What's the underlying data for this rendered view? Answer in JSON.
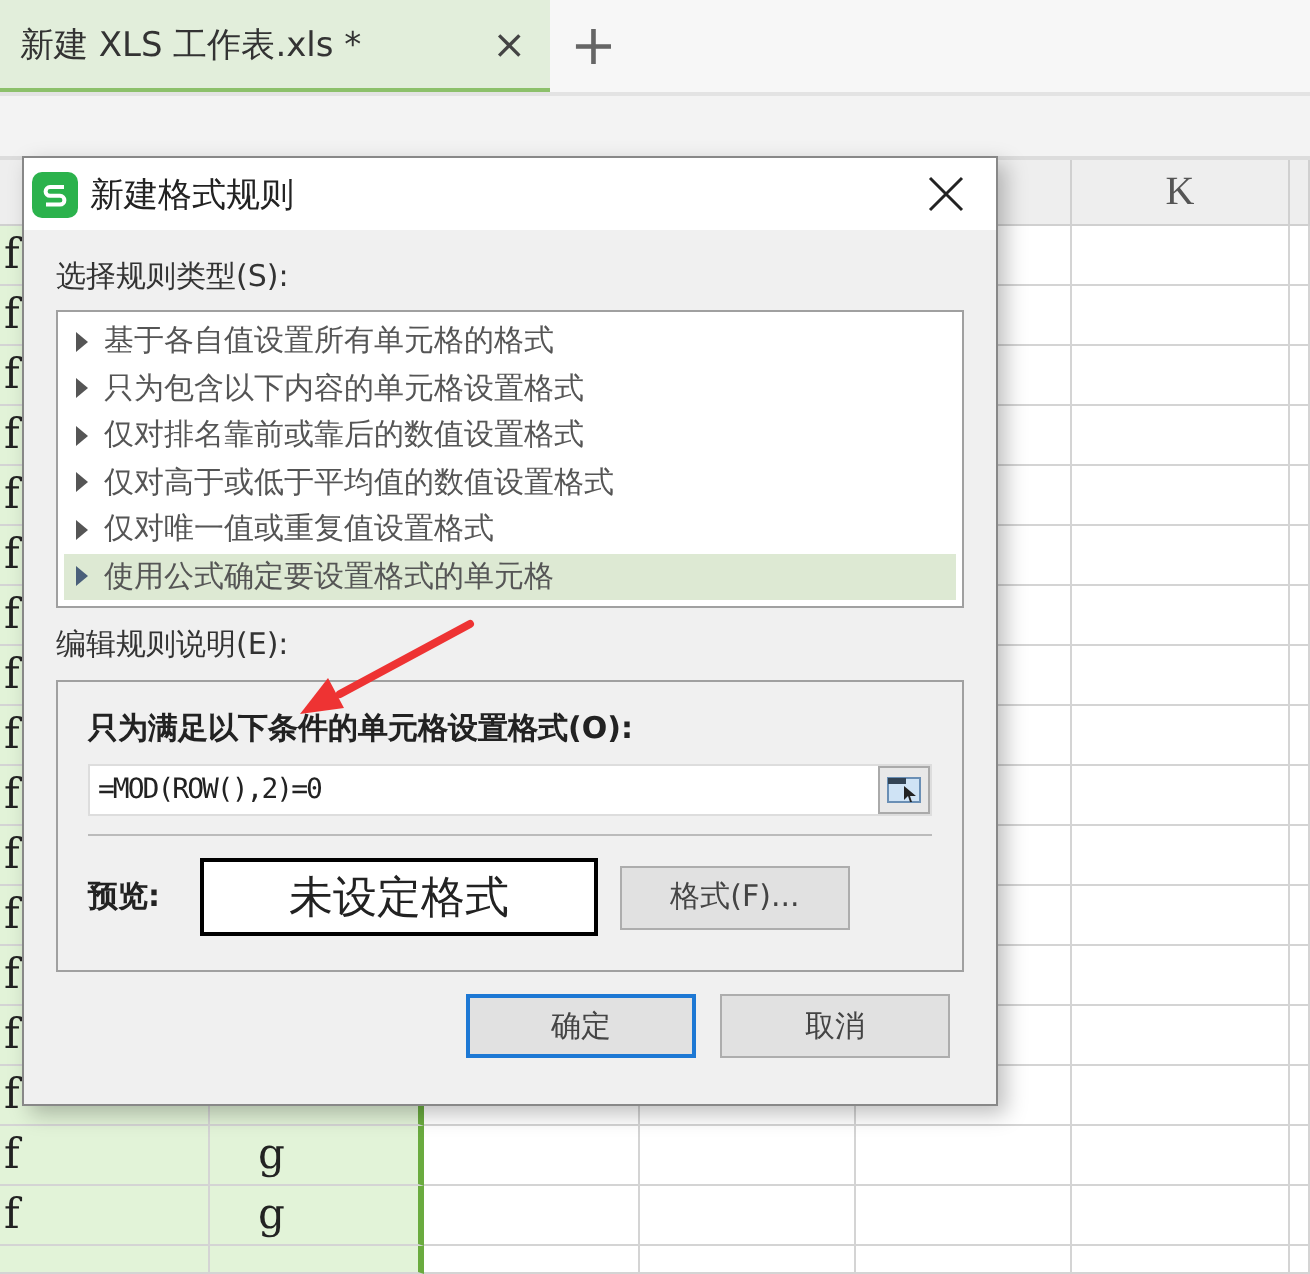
{
  "tabs": [
    {
      "label": "新建 XLS 工作表.xls *",
      "selected": true,
      "close": "×"
    }
  ],
  "new_tab": "+",
  "sheet": {
    "visible_header": "K",
    "rows": [
      {
        "a": "f"
      },
      {
        "a": "f"
      },
      {
        "a": "f"
      },
      {
        "a": "f"
      },
      {
        "a": "f"
      },
      {
        "a": "f"
      },
      {
        "a": "f"
      },
      {
        "a": "f"
      },
      {
        "a": "f"
      },
      {
        "a": "f"
      },
      {
        "a": "f"
      },
      {
        "a": "f"
      },
      {
        "a": "f"
      },
      {
        "a": "f"
      },
      {
        "a": "f"
      },
      {
        "a": "f",
        "b": "g"
      },
      {
        "a": "f",
        "b": "g"
      }
    ]
  },
  "dialog": {
    "title": "新建格式规则",
    "rule_type_label": "选择规则类型(S):",
    "rule_types": [
      {
        "label": "基于各自值设置所有单元格的格式",
        "selected": false
      },
      {
        "label": "只为包含以下内容的单元格设置格式",
        "selected": false
      },
      {
        "label": "仅对排名靠前或靠后的数值设置格式",
        "selected": false
      },
      {
        "label": "仅对高于或低于平均值的数值设置格式",
        "selected": false
      },
      {
        "label": "仅对唯一值或重复值设置格式",
        "selected": false
      },
      {
        "label": "使用公式确定要设置格式的单元格",
        "selected": true
      }
    ],
    "edit_label": "编辑规则说明(E):",
    "condition_label": "只为满足以下条件的单元格设置格式(O):",
    "formula": "=MOD(ROW(),2)=0",
    "preview_label": "预览:",
    "preview_text": "未设定格式",
    "format_button": "格式(F)...",
    "buttons": [
      {
        "label": "确定",
        "default": true
      },
      {
        "label": "取消",
        "default": false
      }
    ]
  }
}
